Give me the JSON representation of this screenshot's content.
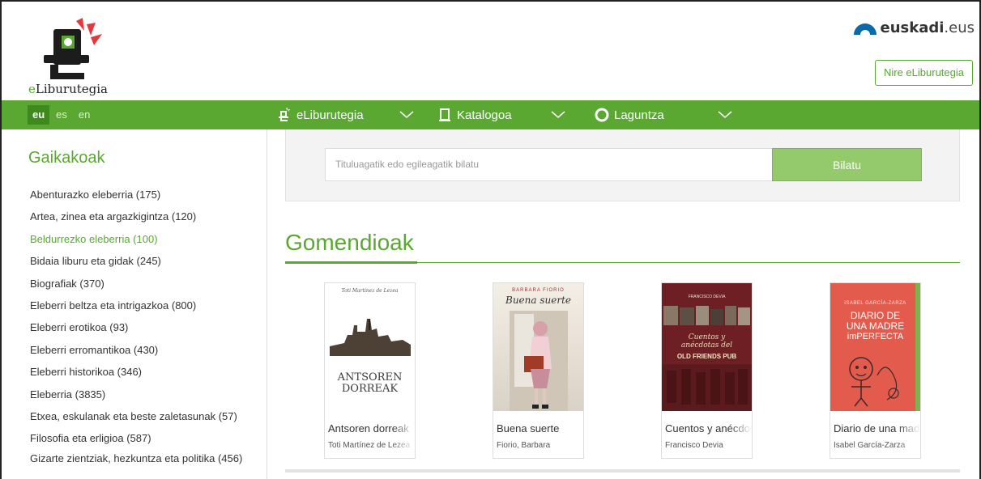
{
  "header": {
    "logo_text_prefix": "e",
    "logo_text_rest": "Liburutegia",
    "euskadi_brand": "euskadi",
    "euskadi_domain": ".eus",
    "nire_button": "Nire eLiburutegia"
  },
  "nav": {
    "languages": [
      "eu",
      "es",
      "en"
    ],
    "active_language": "eu",
    "menu": [
      {
        "label": "eLiburutegia",
        "icon": "eliburutegia-icon"
      },
      {
        "label": "Katalogoa",
        "icon": "book-icon"
      },
      {
        "label": "Laguntza",
        "icon": "lifebuoy-icon"
      }
    ]
  },
  "sidebar": {
    "title": "Gaikakoak",
    "categories": [
      "Abenturazko eleberria (175)",
      "Artea, zinea eta argazkigintza (120)",
      "Beldurrezko eleberria (100)",
      "Bidaia liburu eta gidak (245)",
      "Biografiak (370)",
      "Eleberri beltza eta intrigazkoa (800)",
      "Eleberri erotikoa (93)",
      "Eleberri erromantikoa (430)",
      "Eleberri historikoa (346)",
      "Eleberria (3835)",
      "Etxea, eskulanak eta beste zaletasunak (57)",
      "Filosofia eta erligioa (587)",
      "Gizarte zientziak, hezkuntza eta politika (456)"
    ],
    "active_index": 2
  },
  "search": {
    "placeholder": "Tituluagatik edo egileagatik bilatu",
    "button": "Bilatu"
  },
  "recommendations": {
    "title": "Gomendioak",
    "books": [
      {
        "title": "Antsoren dorreak",
        "author": "Toti Martínez de Lezea",
        "cover_author": "Toti Martínez de Lezea",
        "cover_title_1": "ANTSOREN",
        "cover_title_2": "DORREAK"
      },
      {
        "title": "Buena suerte",
        "author": "Fiorio, Barbara",
        "cover_author": "BARBARA FIORIO",
        "cover_title_1": "Buena suerte"
      },
      {
        "title": "Cuentos y anécdotas del Old Friends Pub",
        "author": "Francisco Devia",
        "cover_author": "FRANCISCO DEVIA",
        "cover_title_1": "Cuentos y",
        "cover_title_2": "anécdotas del",
        "cover_title_3": "OLD FRIENDS PUB"
      },
      {
        "title": "Diario de una madre imperfecta",
        "author": "Isabel García-Zarza",
        "cover_author": "ISABEL GARCÍA-ZARZA",
        "cover_title_1": "DIARIO DE",
        "cover_title_2": "UNA MADRE",
        "cover_title_3": "imPERFECTA"
      }
    ]
  },
  "colors": {
    "brand_green": "#5aa832",
    "search_button": "#94c96c",
    "nav_active": "#3f8a1e"
  }
}
